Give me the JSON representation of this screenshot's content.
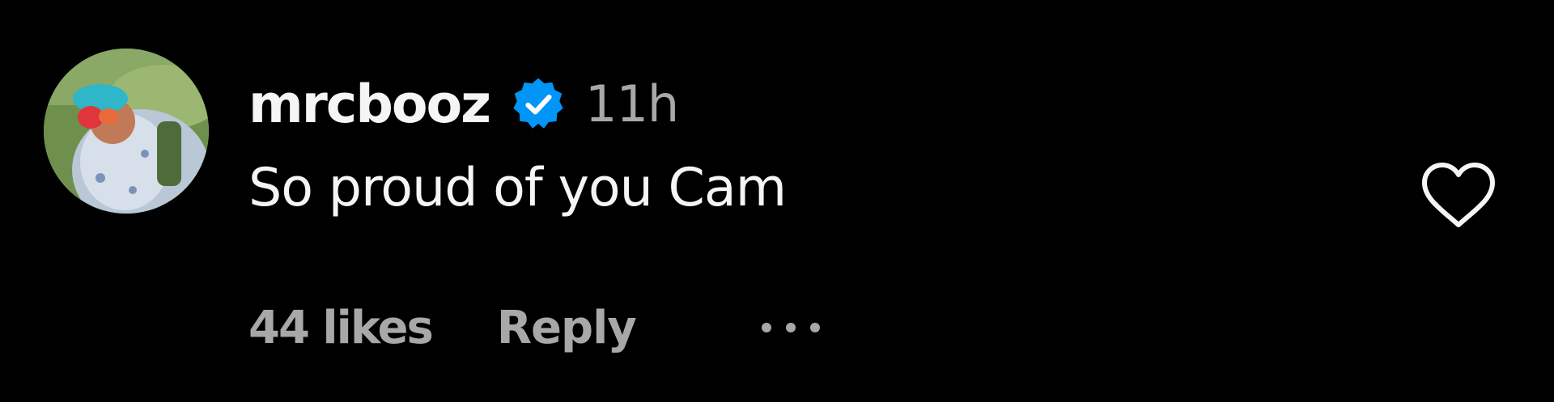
{
  "comment": {
    "username": "mrcbooz",
    "verified_icon": "verified-badge-icon",
    "timestamp": "11h",
    "text": "So proud of you Cam",
    "likes": "44 likes",
    "reply_label": "Reply",
    "more_icon": "more-options-icon",
    "like_icon": "heart-outline-icon"
  },
  "colors": {
    "background": "#000000",
    "primary_text": "#f5f5f5",
    "secondary_text": "#a8a8a8",
    "verified_blue": "#0095f6"
  }
}
